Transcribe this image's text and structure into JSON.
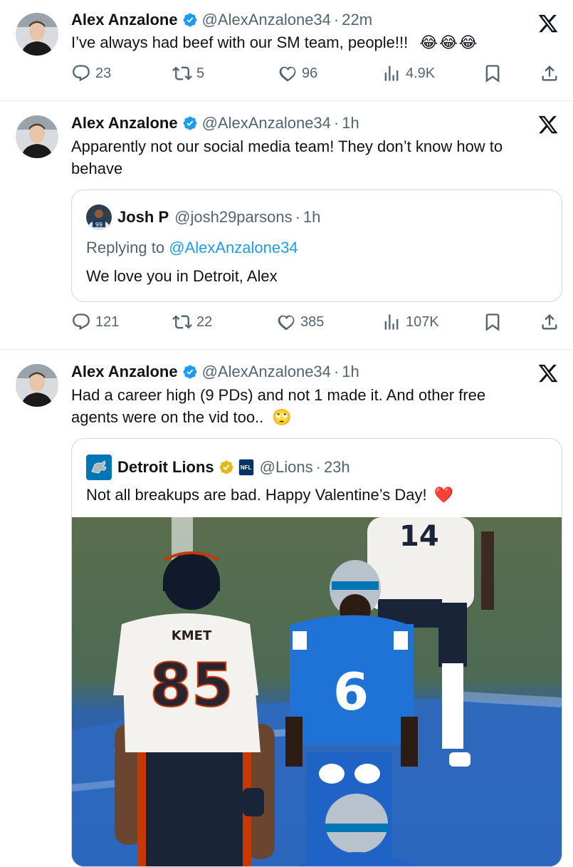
{
  "tweets": [
    {
      "author_name": "Alex Anzalone",
      "handle": "@AlexAnzalone34",
      "time": "22m",
      "text": "I’ve always had beef with our SM team, people!!!",
      "emoji": "😂😂😂",
      "replies": "23",
      "reposts": "5",
      "likes": "96",
      "views": "4.9K"
    },
    {
      "author_name": "Alex Anzalone",
      "handle": "@AlexAnzalone34",
      "time": "1h",
      "text_line1": "Apparently not our social media team! They don’t know how to",
      "text_line2": "behave",
      "quote": {
        "author_name": "Josh P",
        "handle": "@josh29parsons",
        "time": "1h",
        "replying_label": "Replying to",
        "replying_handle": "@AlexAnzalone34",
        "text": "We love you in Detroit, Alex",
        "avatar_number": "99"
      },
      "replies": "121",
      "reposts": "22",
      "likes": "385",
      "views": "107K"
    },
    {
      "author_name": "Alex Anzalone",
      "handle": "@AlexAnzalone34",
      "time": "1h",
      "text_line1": "Had a career high (9 PDs) and not 1 made it. And other free",
      "text_line2": "agents were on the vid too..",
      "emoji": "🙄",
      "quote": {
        "author_name": "Detroit Lions",
        "handle": "@Lions",
        "time": "23h",
        "badge": "NFL",
        "text": "Not all breakups are bad. Happy Valentine’s Day!",
        "emoji": "❤️",
        "media": {
          "jersey_chicago_name": "KMET",
          "jersey_chicago_number": "85",
          "jersey_detroit_number": "6",
          "jersey_background_number": "14"
        }
      }
    }
  ],
  "colors": {
    "text": "#0f1419",
    "secondary": "#536471",
    "link": "#1d9bf0",
    "verified_blue": "#1d9bf0",
    "verified_gold": "#e2b719",
    "heart": "#e0245e",
    "lions_blue": "#0076b6",
    "bears_navy": "#0b162a",
    "bears_orange": "#c83803"
  },
  "icons": [
    "reply-icon",
    "repost-icon",
    "like-icon",
    "views-icon",
    "bookmark-icon",
    "share-icon",
    "x-logo-icon",
    "verified-badge-icon"
  ]
}
